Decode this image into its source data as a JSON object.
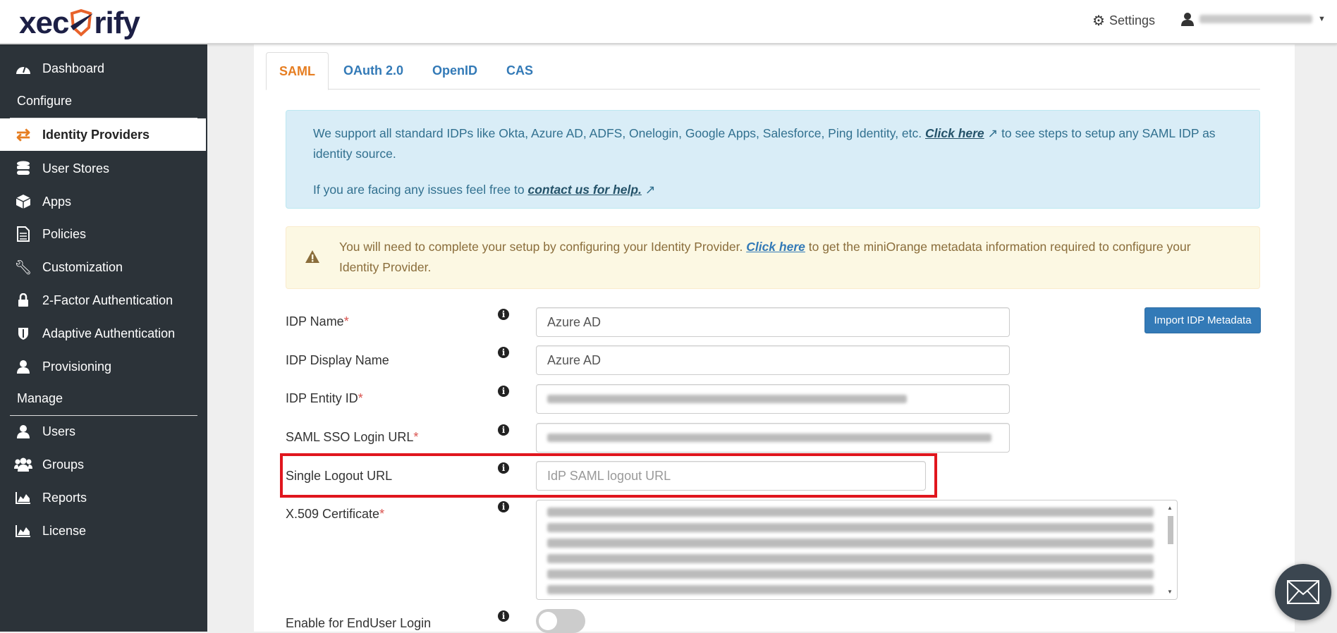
{
  "header": {
    "logo_text_left": "xec",
    "logo_text_right": "rify",
    "settings_label": "Settings"
  },
  "sidebar": {
    "items": [
      {
        "label": "Dashboard",
        "icon": "dashboard-icon"
      },
      {
        "label": "Identity Providers",
        "icon": "exchange-icon",
        "active": true
      },
      {
        "label": "User Stores",
        "icon": "database-icon"
      },
      {
        "label": "Apps",
        "icon": "cube-icon"
      },
      {
        "label": "Policies",
        "icon": "file-icon"
      },
      {
        "label": "Customization",
        "icon": "wrench-icon"
      },
      {
        "label": "2-Factor Authentication",
        "icon": "lock-icon"
      },
      {
        "label": "Adaptive Authentication",
        "icon": "shield-icon"
      },
      {
        "label": "Provisioning",
        "icon": "user-icon"
      },
      {
        "label": "Users",
        "icon": "user-icon"
      },
      {
        "label": "Groups",
        "icon": "users-icon"
      },
      {
        "label": "Reports",
        "icon": "area-chart-icon"
      },
      {
        "label": "License",
        "icon": "area-chart-icon"
      }
    ],
    "sections": {
      "configure": "Configure",
      "manage": "Manage"
    }
  },
  "tabs": [
    {
      "label": "SAML",
      "active": true
    },
    {
      "label": "OAuth 2.0"
    },
    {
      "label": "OpenID"
    },
    {
      "label": "CAS"
    }
  ],
  "info_alert": {
    "text1": "We support all standard IDPs like Okta, Azure AD, ADFS, Onelogin, Google Apps, Salesforce, Ping Identity, etc.",
    "link1": "Click here",
    "text2": "to see steps to setup any SAML IDP as identity source.",
    "text3": "If you are facing any issues feel free to",
    "link2": "contact us for help."
  },
  "warning_alert": {
    "text1": "You will need to complete your setup by configuring your Identity Provider.",
    "link": "Click here",
    "text2": "to get the miniOrange metadata information required to configure your Identity Provider."
  },
  "form": {
    "idp_name": {
      "label": "IDP Name",
      "value": "Azure AD"
    },
    "idp_display_name": {
      "label": "IDP Display Name",
      "value": "Azure AD"
    },
    "idp_entity_id": {
      "label": "IDP Entity ID"
    },
    "saml_sso_url": {
      "label": "SAML SSO Login URL"
    },
    "single_logout_url": {
      "label": "Single Logout URL",
      "value": "",
      "placeholder": "IdP SAML logout URL"
    },
    "certificate": {
      "label": "X.509 Certificate"
    },
    "enduser_login": {
      "label": "Enable for EndUser Login",
      "enabled": false
    },
    "required_mark": "*",
    "import_button": "Import IDP Metadata"
  },
  "colors": {
    "accent": "#e67e22",
    "link": "#337ab7",
    "sidebar_bg": "#2c3339",
    "highlight": "#e0161e"
  }
}
